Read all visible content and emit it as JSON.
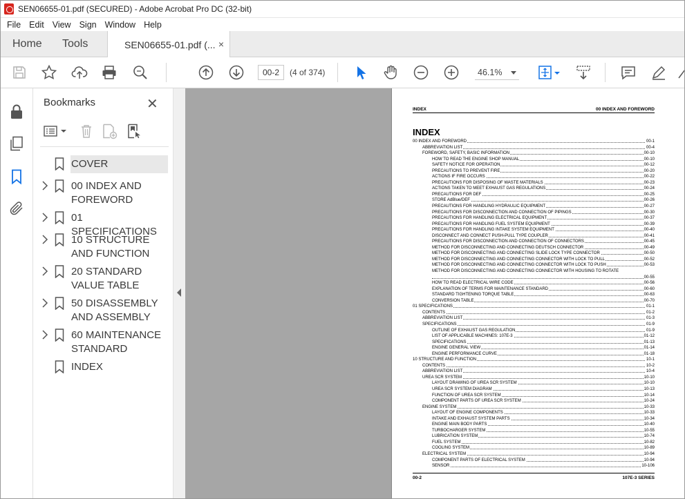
{
  "window": {
    "title": "SEN06655-01.pdf (SECURED) - Adobe Acrobat Pro DC (32-bit)",
    "icon": "acrobat-icon"
  },
  "menu": [
    "File",
    "Edit",
    "View",
    "Sign",
    "Window",
    "Help"
  ],
  "tabs": {
    "home": "Home",
    "tools": "Tools",
    "document": "SEN06655-01.pdf (...",
    "close": "×"
  },
  "toolbar": {
    "page_current": "00-2",
    "page_count": "(4 of 374)",
    "zoom": "46.1%"
  },
  "bookmarks": {
    "title": "Bookmarks",
    "close": "✕",
    "items": [
      {
        "label": "COVER",
        "has_children": false,
        "selected": true
      },
      {
        "label": "00 INDEX AND FOREWORD",
        "has_children": true
      },
      {
        "label": "01 SPECIFICATIONS",
        "has_children": true
      },
      {
        "label": "10 STRUCTURE AND FUNCTION",
        "has_children": true
      },
      {
        "label": "20 STANDARD VALUE TABLE",
        "has_children": true
      },
      {
        "label": "50 DISASSEMBLY AND ASSEMBLY",
        "has_children": true
      },
      {
        "label": "60 MAINTENANCE STANDARD",
        "has_children": true
      },
      {
        "label": "INDEX",
        "has_children": false
      }
    ]
  },
  "page": {
    "header_left": "INDEX",
    "header_right": "00 INDEX AND FOREWORD",
    "title": "INDEX",
    "footer_left": "00-2",
    "footer_right": "107E-3 SERIES",
    "toc": [
      {
        "level": 0,
        "text": "00 INDEX AND FOREWORD",
        "page": "00-1"
      },
      {
        "level": 1,
        "text": "ABBREVIATION LIST",
        "page": "00-4"
      },
      {
        "level": 1,
        "text": "FOREWORD, SAFETY, BASIC INFORMATION",
        "page": "00-10"
      },
      {
        "level": 2,
        "text": "HOW TO READ THE ENGINE SHOP MANUAL",
        "page": "00-10"
      },
      {
        "level": 2,
        "text": "SAFETY NOTICE FOR OPERATION",
        "page": "00-12"
      },
      {
        "level": 2,
        "text": "PRECAUTIONS TO PREVENT FIRE",
        "page": "00-20"
      },
      {
        "level": 2,
        "text": "ACTIONS IF FIRE OCCURS",
        "page": "00-22"
      },
      {
        "level": 2,
        "text": "PRECAUTIONS FOR DISPOSING OF WASTE MATERIALS",
        "page": "00-23"
      },
      {
        "level": 2,
        "text": "ACTIONS TAKEN TO MEET EXHAUST GAS REGULATIONS",
        "page": "00-24"
      },
      {
        "level": 2,
        "text": "PRECAUTIONS FOR DEF",
        "page": "00-25"
      },
      {
        "level": 2,
        "text": "STORE AdBlue/DEF",
        "page": "00-26"
      },
      {
        "level": 2,
        "text": "PRECAUTIONS FOR HANDLING HYDRAULIC EQUIPMENT",
        "page": "00-27"
      },
      {
        "level": 2,
        "text": "PRECAUTIONS FOR DISCONNECTION AND CONNECTION OF PIPINGS",
        "page": "00-30"
      },
      {
        "level": 2,
        "text": "PRECAUTIONS FOR HANDLING ELECTRICAL EQUIPMENT",
        "page": "00-37"
      },
      {
        "level": 2,
        "text": "PRECAUTIONS FOR HANDLING FUEL SYSTEM EQUIPMENT",
        "page": "00-39"
      },
      {
        "level": 2,
        "text": "PRECAUTIONS FOR HANDLING INTAKE SYSTEM EQUIPMENT",
        "page": "00-40"
      },
      {
        "level": 2,
        "text": "DISCONNECT AND CONNECT PUSH-PULL TYPE COUPLER",
        "page": "00-41"
      },
      {
        "level": 2,
        "text": "PRECAUTIONS FOR DISCONNECTION AND CONNECTION OF CONNECTORS",
        "page": "00-45"
      },
      {
        "level": 2,
        "text": "METHOD FOR DISCONNECTING AND CONNECTING DEUTSCH CONNECTOR",
        "page": "00-49"
      },
      {
        "level": 2,
        "text": "METHOD FOR DISCONNECTING AND CONNECTING SLIDE LOCK TYPE CONNECTOR",
        "page": "00-50"
      },
      {
        "level": 2,
        "text": "METHOD FOR DISCONNECTING AND CONNECTING CONNECTOR WITH LOCK TO PULL",
        "page": "00-52"
      },
      {
        "level": 2,
        "text": "METHOD FOR DISCONNECTING AND CONNECTING CONNECTOR WITH LOCK TO PUSH",
        "page": "00-53"
      },
      {
        "level": 2,
        "text": "METHOD FOR DISCONNECTING AND CONNECTING CONNECTOR WITH HOUSING TO ROTATE",
        "page": ""
      },
      {
        "level": 2,
        "text": "",
        "page": "00-55"
      },
      {
        "level": 2,
        "text": "HOW TO READ ELECTRICAL WIRE CODE",
        "page": "00-56"
      },
      {
        "level": 2,
        "text": "EXPLANATION OF TERMS FOR MAINTENANCE STANDARD",
        "page": "00-60"
      },
      {
        "level": 2,
        "text": "STANDARD TIGHTENING TORQUE TABLE",
        "page": "00-63"
      },
      {
        "level": 2,
        "text": "CONVERSION TABLE",
        "page": "00-70"
      },
      {
        "level": 0,
        "text": "01 SPECIFICATIONS",
        "page": "01-1"
      },
      {
        "level": 1,
        "text": "CONTENTS",
        "page": "01-2"
      },
      {
        "level": 1,
        "text": "ABBREVIATION LIST",
        "page": "01-3"
      },
      {
        "level": 1,
        "text": "SPECIFICATIONS",
        "page": "01-9"
      },
      {
        "level": 2,
        "text": "OUTLINE OF EXHAUST GAS REGULATION",
        "page": "01-9"
      },
      {
        "level": 2,
        "text": "LIST OF APPLICABLE MACHINES: 107E-3",
        "page": "01-12"
      },
      {
        "level": 2,
        "text": "SPECIFICATIONS",
        "page": "01-13"
      },
      {
        "level": 2,
        "text": "ENGINE GENERAL VIEW",
        "page": "01-14"
      },
      {
        "level": 2,
        "text": "ENGINE PERFORMANCE CURVE",
        "page": "01-18"
      },
      {
        "level": 0,
        "text": "10 STRUCTURE AND FUNCTION",
        "page": "10-1"
      },
      {
        "level": 1,
        "text": "CONTENTS",
        "page": "10-2"
      },
      {
        "level": 1,
        "text": "ABBREVIATION LIST",
        "page": "10-4"
      },
      {
        "level": 1,
        "text": "UREA SCR SYSTEM",
        "page": "10-10"
      },
      {
        "level": 2,
        "text": "LAYOUT DRAWING OF UREA SCR SYSTEM",
        "page": "10-10"
      },
      {
        "level": 2,
        "text": "UREA SCR SYSTEM DIAGRAM",
        "page": "10-13"
      },
      {
        "level": 2,
        "text": "FUNCTION OF UREA SCR SYSTEM",
        "page": "10-14"
      },
      {
        "level": 2,
        "text": "COMPONENT PARTS OF UREA SCR SYSTEM",
        "page": "10-24"
      },
      {
        "level": 1,
        "text": "ENGINE SYSTEM",
        "page": "10-33"
      },
      {
        "level": 2,
        "text": "LAYOUT OF ENGINE COMPONENTS",
        "page": "10-33"
      },
      {
        "level": 2,
        "text": "INTAKE AND EXHAUST SYSTEM PARTS",
        "page": "10-34"
      },
      {
        "level": 2,
        "text": "ENGINE MAIN BODY PARTS",
        "page": "10-40"
      },
      {
        "level": 2,
        "text": "TURBOCHARGER SYSTEM",
        "page": "10-55"
      },
      {
        "level": 2,
        "text": "LUBRICATION SYSTEM",
        "page": "10-74"
      },
      {
        "level": 2,
        "text": "FUEL SYSTEM",
        "page": "10-82"
      },
      {
        "level": 2,
        "text": "COOLING SYSTEM",
        "page": "10-89"
      },
      {
        "level": 1,
        "text": "ELECTRICAL SYSTEM",
        "page": "10-94"
      },
      {
        "level": 2,
        "text": "COMPONENT PARTS OF ELECTRICAL SYSTEM",
        "page": "10-94"
      },
      {
        "level": 2,
        "text": "SENSOR",
        "page": "10-106"
      }
    ]
  }
}
